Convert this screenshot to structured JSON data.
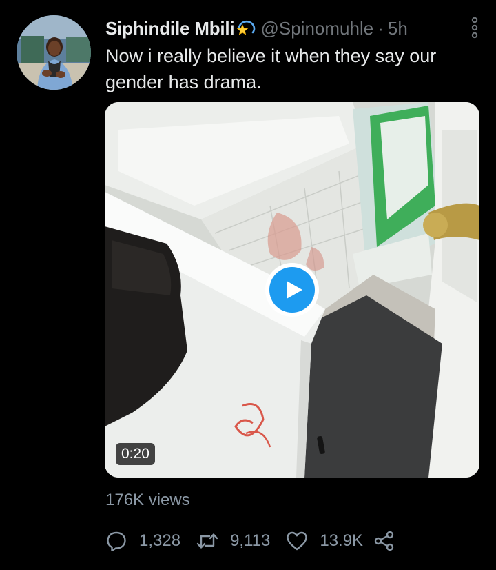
{
  "author": {
    "display_name": "Siphindile Mbili",
    "handle": "@Spinomuhle",
    "separator": "·",
    "timestamp": "5h",
    "name_emoji": "dizzy-emoji"
  },
  "tweet": {
    "text": "Now i really believe it when they say our gender has drama."
  },
  "media": {
    "type": "video",
    "duration": "0:20",
    "play_icon": "play-icon",
    "accent_color": "#1d9bf0"
  },
  "stats": {
    "views": "176K views"
  },
  "actions": {
    "reply_count": "1,328",
    "retweet_count": "9,113",
    "like_count": "13.9K",
    "icons": [
      "reply-icon",
      "retweet-icon",
      "like-icon",
      "share-icon"
    ]
  },
  "colors": {
    "background": "#000000",
    "text_primary": "#e7e9ea",
    "text_secondary": "#71767b",
    "accent": "#1d9bf0"
  }
}
